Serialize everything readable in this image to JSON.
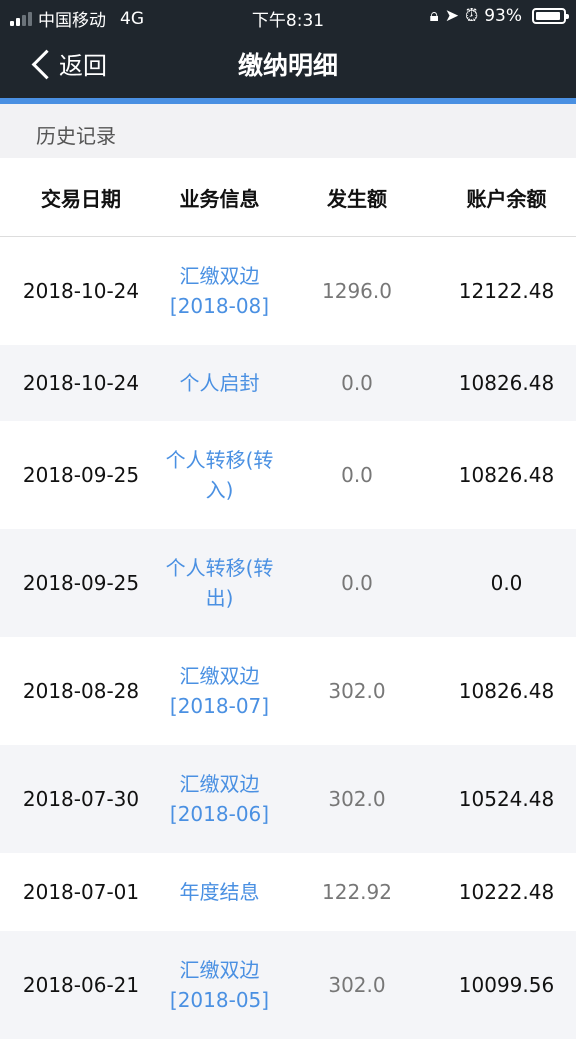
{
  "status_bar": {
    "carrier": "中国移动",
    "network": "4G",
    "time": "下午8:31",
    "battery_percent": "93%",
    "battery_level": 0.93,
    "signal_bars": 2
  },
  "nav": {
    "back_label": "返回",
    "title": "缴纳明细"
  },
  "section_title": "历史记录",
  "columns": [
    "交易日期",
    "业务信息",
    "发生额",
    "账户余额"
  ],
  "rows": [
    {
      "date": "2018-10-24",
      "info": "汇缴双边\n[2018-08]",
      "amount": "1296.0",
      "balance": "12122.48"
    },
    {
      "date": "2018-10-24",
      "info": "个人启封",
      "amount": "0.0",
      "balance": "10826.48"
    },
    {
      "date": "2018-09-25",
      "info": "个人转移(转\n入)",
      "amount": "0.0",
      "balance": "10826.48"
    },
    {
      "date": "2018-09-25",
      "info": "个人转移(转\n出)",
      "amount": "0.0",
      "balance": "0.0"
    },
    {
      "date": "2018-08-28",
      "info": "汇缴双边\n[2018-07]",
      "amount": "302.0",
      "balance": "10826.48"
    },
    {
      "date": "2018-07-30",
      "info": "汇缴双边\n[2018-06]",
      "amount": "302.0",
      "balance": "10524.48"
    },
    {
      "date": "2018-07-01",
      "info": "年度结息",
      "amount": "122.92",
      "balance": "10222.48"
    },
    {
      "date": "2018-06-21",
      "info": "汇缴双边\n[2018-05]",
      "amount": "302.0",
      "balance": "10099.56"
    }
  ],
  "colors": {
    "header_bg": "#1f262d",
    "accent_blue": "#4a90e2",
    "link_text": "#4a90e2",
    "section_bg": "#f2f2f4"
  }
}
